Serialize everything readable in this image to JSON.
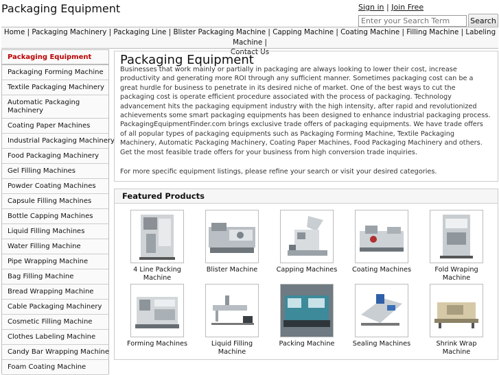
{
  "header": {
    "title": "Packaging Equipment",
    "sign_in": "Sign in",
    "join_free": "Join Free",
    "auth_separator": "|",
    "search_placeholder": "Enter your Search Term",
    "search_button": "Search"
  },
  "nav": {
    "items": [
      "Home",
      "Packaging Machinery",
      "Packaging Line",
      "Blister Packaging Machine",
      "Capping Machine",
      "Coating Machine",
      "Filling Machine",
      "Labeling Machine",
      "Contact Us"
    ],
    "separator": "|"
  },
  "sidebar": {
    "items": [
      "Packaging Equipment",
      "Packaging Forming Machine",
      "Textile Packaging Machinery",
      "Automatic Packaging Machinery",
      "Coating Paper Machines",
      "Industrial Packaging Machinery",
      "Food Packaging Machinery",
      "Gel Filling Machines",
      "Powder Coating Machines",
      "Capsule Filling Machines",
      "Bottle Capping Machines",
      "Liquid Filling Machines",
      "Water Filling Machine",
      "Pipe Wrapping Machine",
      "Bag Filling Machine",
      "Bread Wrapping Machine",
      "Cable Packaging Machinery",
      "Cosmetic Filling Machine",
      "Clothes Labeling Machine",
      "Candy Bar Wrapping Machine",
      "Foam Coating Machine"
    ],
    "active_color": "#bb0000"
  },
  "main": {
    "heading": "Packaging Equipment",
    "intro": "Businesses that work mainly or partially in packaging are always looking to lower their cost, increase productivity and generating more ROI through any sufficient manner. Sometimes packaging cost can be a great hurdle for business to penetrate in its desired niche of market. One of the best ways to cut the packaging cost is operate efficient procedure associated with the process of packaging. Technology advancement hits the packaging equipment industry with the high intensity, after rapid and revolutionized achievements some smart packaging equipments has been designed to enhance industrial packaging process. PackagingEquipmentFinder.com brings exclusive trade offers of packaging equipments. We have trade offers of all popular types of packaging equipments such as Packaging Forming Machine, Textile Packaging Machinery, Automatic Packaging Machinery, Coating Paper Machines, Food Packaging Machinery and others. Get the most feasible trade offers for your business from high conversion trade inquiries.",
    "more": "For more specific equipment listings, please refine your search or visit your desired categories."
  },
  "featured": {
    "heading": "Featured Products",
    "products": [
      {
        "label": "4 Line Packing Machine",
        "icon": "vertical-packing-machine"
      },
      {
        "label": "Blister Machine",
        "icon": "blister-machine"
      },
      {
        "label": "Capping Machines",
        "icon": "capping-machine"
      },
      {
        "label": "Coating Machines",
        "icon": "coating-machine"
      },
      {
        "label": "Fold Wraping Machine",
        "icon": "fold-wrapping-machine"
      },
      {
        "label": "Forming Machines",
        "icon": "forming-machine"
      },
      {
        "label": "Liquid Filling Machine",
        "icon": "liquid-filling-machine"
      },
      {
        "label": "Packing Machine",
        "icon": "packing-machine"
      },
      {
        "label": "Sealing Machines",
        "icon": "sealing-machine"
      },
      {
        "label": "Shrink Wrap Machine",
        "icon": "shrink-wrap-machine"
      }
    ]
  }
}
